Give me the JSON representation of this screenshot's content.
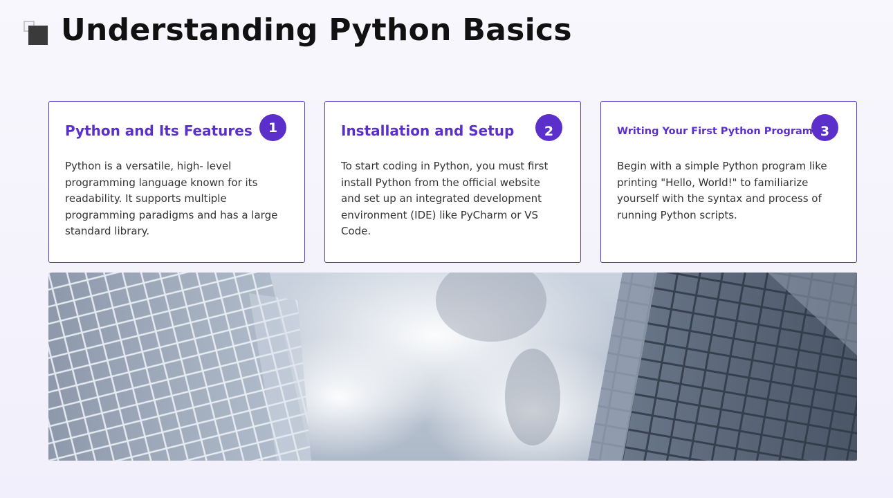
{
  "header": {
    "title": "Understanding Python Basics",
    "icon": "slide-square-icon"
  },
  "cards": [
    {
      "number": "1",
      "title": "Python and Its Features",
      "body": "Python is a versatile, high- level programming language known for its readability. It supports multiple programming paradigms and has a large standard library."
    },
    {
      "number": "2",
      "title": "Installation and Setup",
      "body": "To start coding in Python, you must first install Python from the official website and set up an integrated development environment (IDE) like PyCharm or VS Code."
    },
    {
      "number": "3",
      "title": "Writing Your First Python Program",
      "body": "Begin with a simple Python program like printing \"Hello, World!\" to familiarize yourself with the syntax and process of running Python scripts."
    }
  ],
  "banner": {
    "image": "skyscrapers-sky-photo"
  },
  "colors": {
    "accent": "#5b2fc9",
    "title": "#111111",
    "body_text": "#333333",
    "background": "#f4f2fc"
  }
}
